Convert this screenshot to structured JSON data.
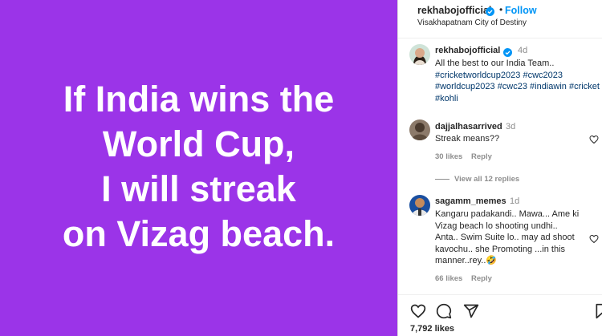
{
  "post": {
    "image_lines": [
      "If India wins the",
      "World Cup,",
      "I will streak",
      "on Vizag beach."
    ],
    "background_color": "#9b34e8"
  },
  "header": {
    "username": "rekhabojofficial",
    "dot": "•",
    "follow_label": "Follow",
    "location": "Visakhapatnam City of Destiny"
  },
  "caption": {
    "username": "rekhabojofficial",
    "time": "4d",
    "text": "All the best to our India Team..",
    "hashtags": [
      "#cricketworldcup2023",
      "#cwc2023",
      "#worldcup2023",
      "#cwc23",
      "#indiawin",
      "#cricket",
      "#kohli"
    ]
  },
  "comments": [
    {
      "username": "dajjalhasarrived",
      "time": "3d",
      "text": "Streak means??",
      "likes": "30 likes",
      "reply_label": "Reply"
    },
    {
      "username": "sagamm_memes",
      "time": "1d",
      "text": "Kangaru padakandi.. Mawa... Ame ki Vizag beach lo shooting undhi.. Anta.. Swim Suite lo.. may ad shoot kavochu.. she Promoting ...in this manner..rey..",
      "emoji": "🤣",
      "likes": "66 likes",
      "reply_label": "Reply"
    }
  ],
  "view_replies_label": "View all 12 replies",
  "likes_count": "7,792 likes",
  "icons": [
    "verified-icon",
    "heart-icon",
    "comment-icon",
    "share-icon",
    "bookmark-icon"
  ],
  "accent_color": "#0095f6"
}
